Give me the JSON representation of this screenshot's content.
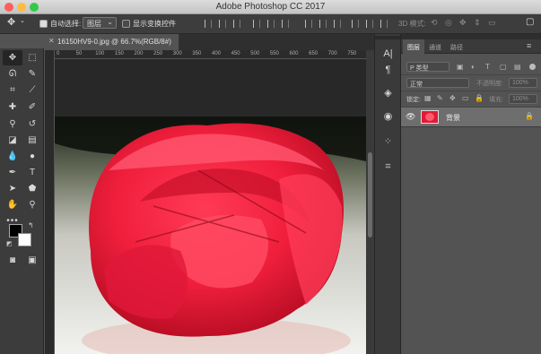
{
  "window": {
    "title": "Adobe Photoshop CC 2017"
  },
  "options_bar": {
    "auto_select_label": "自动选择:",
    "auto_select_value": "图层",
    "show_transform_label": "显示变换控件",
    "mode_3d_label": "3D 模式:"
  },
  "document": {
    "tab_label": "16150HV9-0.jpg @ 66.7%(RGB/8#)"
  },
  "ruler": {
    "top_ticks": [
      "0",
      "50",
      "100",
      "150",
      "200",
      "250",
      "300",
      "350",
      "400",
      "450",
      "500",
      "550",
      "600",
      "650",
      "700",
      "750"
    ]
  },
  "layers_panel": {
    "tabs": [
      "图层",
      "通道",
      "路径"
    ],
    "filter_label": "P 类型",
    "blend_mode": "正常",
    "opacity_label": "不透明度:",
    "opacity_value": "100%",
    "lock_label": "锁定:",
    "fill_label": "填充:",
    "fill_value": "100%",
    "layers": [
      {
        "name": "背景"
      }
    ]
  },
  "colors": {
    "foreground": "#000000",
    "background": "#ffffff"
  }
}
